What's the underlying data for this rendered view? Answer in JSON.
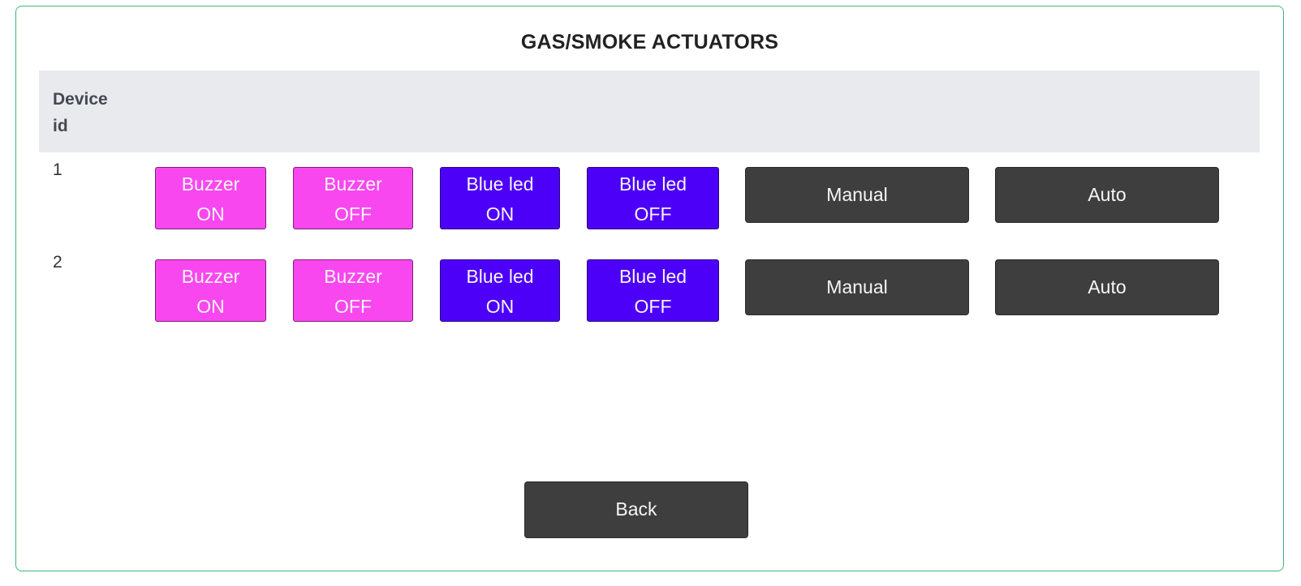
{
  "page": {
    "title": "GAS/SMOKE ACTUATORS"
  },
  "table": {
    "header": {
      "device_id_line1": "Device",
      "device_id_line2": "id"
    },
    "rows": [
      {
        "id": "1",
        "buzzer_on": [
          "Buzzer",
          "ON"
        ],
        "buzzer_off": [
          "Buzzer",
          "OFF"
        ],
        "blue_led_on": [
          "Blue led",
          "ON"
        ],
        "blue_led_off": [
          "Blue led",
          "OFF"
        ],
        "manual": "Manual",
        "auto": "Auto"
      },
      {
        "id": "2",
        "buzzer_on": [
          "Buzzer",
          "ON"
        ],
        "buzzer_off": [
          "Buzzer",
          "OFF"
        ],
        "blue_led_on": [
          "Blue led",
          "ON"
        ],
        "blue_led_off": [
          "Blue led",
          "OFF"
        ],
        "manual": "Manual",
        "auto": "Auto"
      }
    ]
  },
  "footer": {
    "back_label": "Back"
  },
  "colors": {
    "buzzer": "#f947f0",
    "blue_led": "#4d00f8",
    "dark_button": "#3e3e3e",
    "panel_border": "#3cb878",
    "header_bg": "#e8eaed"
  }
}
